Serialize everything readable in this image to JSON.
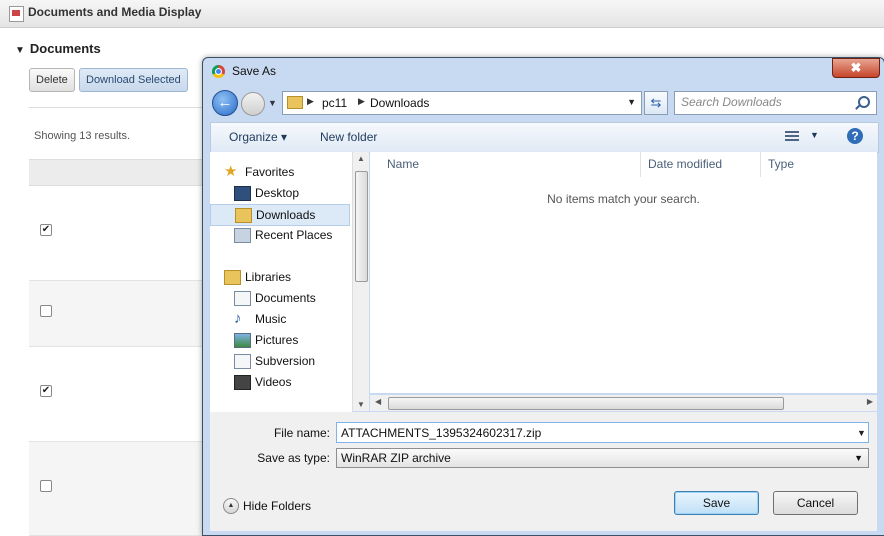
{
  "background": {
    "portlet_title": "Documents and Media Display",
    "section_title": "Documents",
    "delete_label": "Delete",
    "download_label": "Download Selected",
    "results_text": "Showing 13 results.",
    "rows_checked": [
      "✔",
      "",
      "✔",
      ""
    ]
  },
  "dialog": {
    "title": "Save As",
    "close_glyph": "✖",
    "address": {
      "crumbs": [
        "pc11",
        "Downloads"
      ]
    },
    "search_placeholder": "Search Downloads",
    "toolbar": {
      "organize": "Organize ▾",
      "new_folder": "New folder",
      "help": "?"
    },
    "nav": {
      "favorites": "Favorites",
      "favorites_items": [
        "Desktop",
        "Downloads",
        "Recent Places"
      ],
      "libraries": "Libraries",
      "libraries_items": [
        "Documents",
        "Music",
        "Pictures",
        "Subversion",
        "Videos"
      ]
    },
    "columns": {
      "name": "Name",
      "date_modified": "Date modified",
      "type": "Type"
    },
    "empty_message": "No items match your search.",
    "file_name_label": "File name:",
    "file_name_value": "ATTACHMENTS_1395324602317.zip",
    "save_as_type_label": "Save as type:",
    "save_as_type_value": "WinRAR ZIP archive",
    "hide_folders": "Hide Folders",
    "save": "Save",
    "cancel": "Cancel"
  }
}
